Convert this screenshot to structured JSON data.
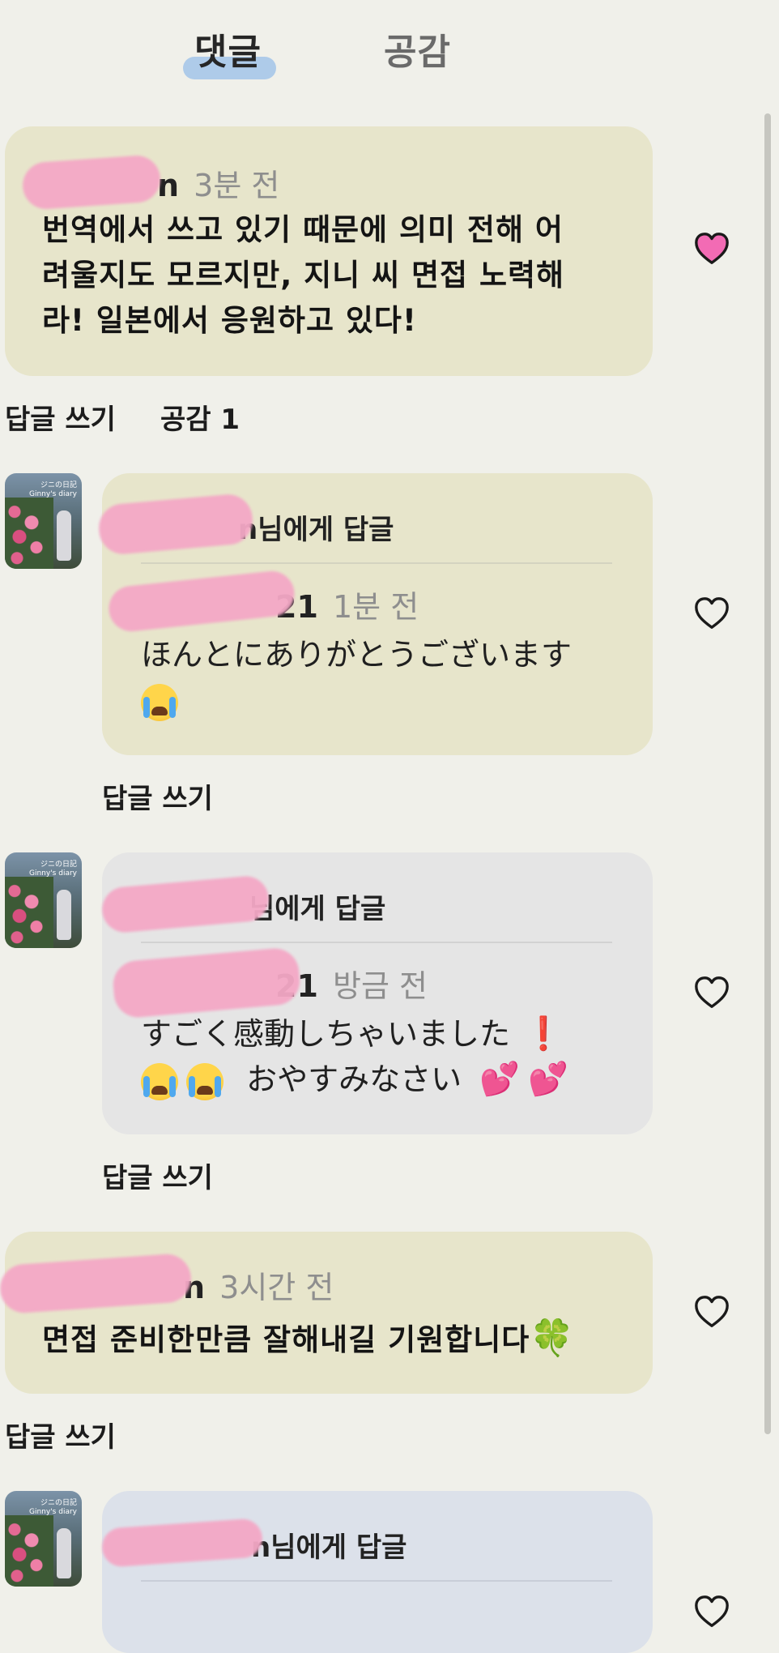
{
  "tabs": {
    "comments": "댓글",
    "likes": "공감"
  },
  "comments": [
    {
      "name_tail": "n",
      "time": "3분 전",
      "text_lines": [
        "번역에서 쓰고 있기 때문에 의미 전해 어",
        "려울지도 모르지만, 지니 씨 면접 노력해",
        "라! 일본에서 응원하고 있다!"
      ],
      "reply_label": "답글 쓰기",
      "like_label": "공감 1",
      "liked": true
    },
    {
      "reply_to_tail": "n님에게 답글",
      "name_tail": "21",
      "time": "1분 전",
      "text": "ほんとにありがとうございます",
      "emoji_line": "😭",
      "reply_label": "답글 쓰기",
      "liked": false
    },
    {
      "reply_to_tail": "님에게 답글",
      "name_tail": "21",
      "time": "방금 전",
      "text": "すごく感動しちゃいました",
      "text_emoji": "❗",
      "line2_text": "おやすみなさい",
      "reply_label": "답글 쓰기",
      "liked": false
    },
    {
      "name_tail": "n",
      "time": "3시간 전",
      "text": "면접 준비한만큼 잘해내길 기원합니다",
      "emoji": "🍀",
      "reply_label": "답글 쓰기",
      "liked": false
    },
    {
      "reply_to_tail": "n님에게 답글",
      "liked": false
    }
  ],
  "avatar_caption": [
    "ジニの日記",
    "Ginny's diary"
  ],
  "colors": {
    "background": "#f0f0ea",
    "bubble_olive": "#e7e5cb",
    "bubble_grey": "#e5e5e5",
    "bubble_blue": "#dce1ea",
    "tab_highlight": "#aecbe9",
    "liked_heart": "#f26bb4",
    "redaction": "#f4a8c6"
  },
  "icons": [
    "heart-filled-icon",
    "heart-outline-icon",
    "avatar-image",
    "loudly-crying-emoji",
    "exclamation-emoji",
    "two-hearts-emoji",
    "clover-emoji"
  ]
}
